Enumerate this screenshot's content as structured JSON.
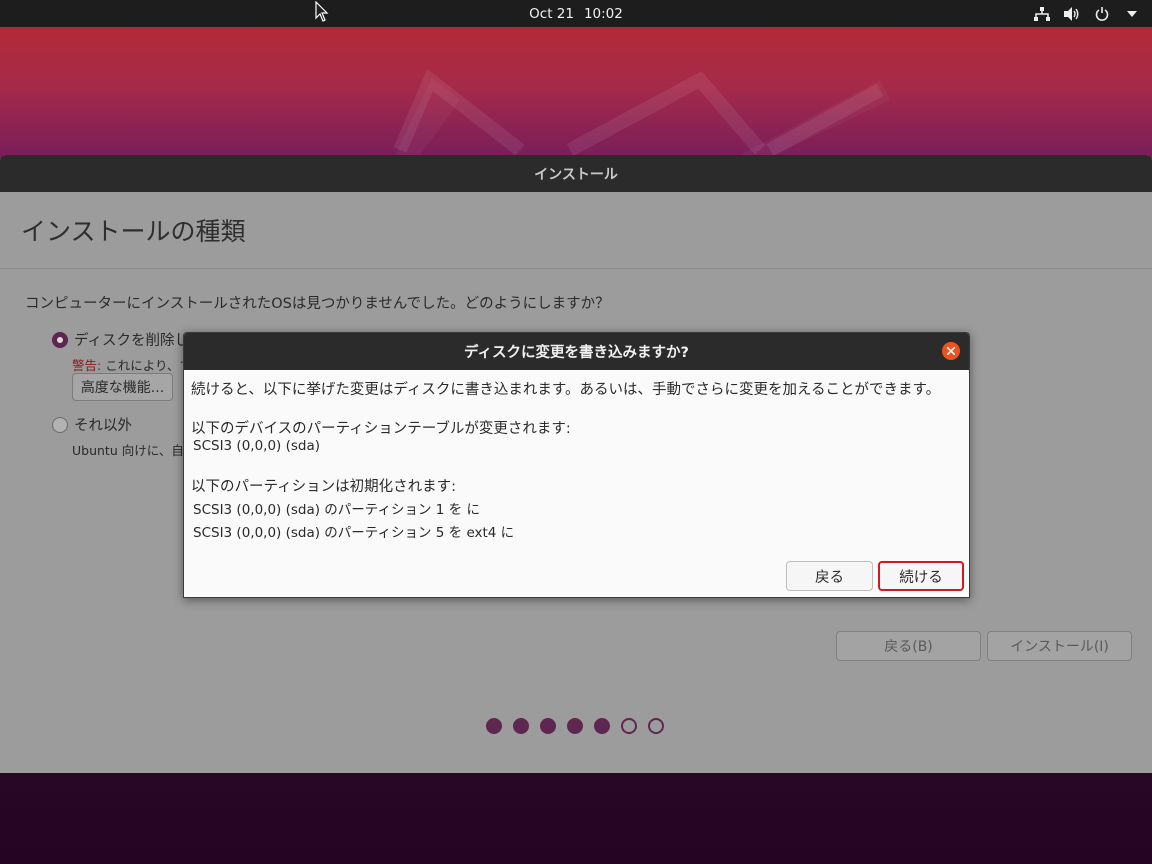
{
  "topbar": {
    "date": "Oct 21",
    "time": "10:02",
    "icons": [
      "network-icon",
      "volume-icon",
      "power-icon",
      "caret-down-icon"
    ]
  },
  "window": {
    "title": "インストール",
    "page_title": "インストールの種類",
    "question": "コンピューターにインストールされたOSは見つかりませんでした。どのようにしますか？",
    "options": [
      {
        "label": "ディスクを削除し",
        "checked": true
      },
      {
        "label": "それ以外",
        "checked": false
      }
    ],
    "warning_prefix": "警告:",
    "warning_text": "これにより、す",
    "advanced_button": "高度な機能...",
    "other_desc": "Ubuntu 向けに、自分",
    "back_button": "戻る(B)",
    "install_button": "インストール(I)",
    "progress": {
      "total": 7,
      "completed": 5
    }
  },
  "dialog": {
    "title": "ディスクに変更を書き込みますか?",
    "intro": "続けると、以下に挙げた変更はディスクに書き込まれます。あるいは、手動でさらに変更を加えることができます。",
    "partition_table_heading": "以下のデバイスのパーティションテーブルが変更されます:",
    "partition_table_devices": [
      "SCSI3 (0,0,0) (sda)"
    ],
    "format_heading": "以下のパーティションは初期化されます:",
    "format_items": [
      "SCSI3 (0,0,0) (sda) のパーティション 1 を  に",
      "SCSI3 (0,0,0) (sda) のパーティション 5 を ext4 に"
    ],
    "back_button": "戻る",
    "continue_button": "続ける"
  },
  "colors": {
    "accent": "#5e2750",
    "close": "#e95420",
    "highlight": "#d1191f"
  }
}
